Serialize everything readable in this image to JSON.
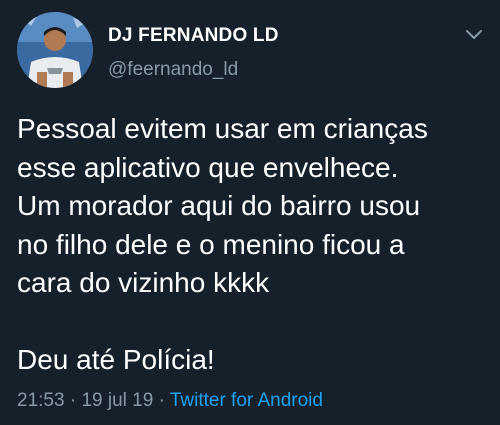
{
  "author": {
    "display_name": "DJ FERNANDO LD",
    "handle": "@feernando_ld"
  },
  "tweet": {
    "lines": [
      "Pessoal evitem usar em crianças",
      "esse aplicativo que envelhece.",
      "Um morador aqui do bairro usou",
      "no filho dele e o menino ficou a",
      "cara do vizinho kkkk"
    ],
    "last_line": "Deu até Polícia!"
  },
  "meta": {
    "time": "21:53",
    "separator": "·",
    "date": "19 jul 19",
    "source": "Twitter for Android"
  },
  "icons": {
    "menu": "chevron-down-icon"
  },
  "colors": {
    "background": "#15202b",
    "text": "#ffffff",
    "secondary": "#8899a6",
    "link": "#1da1f2"
  }
}
